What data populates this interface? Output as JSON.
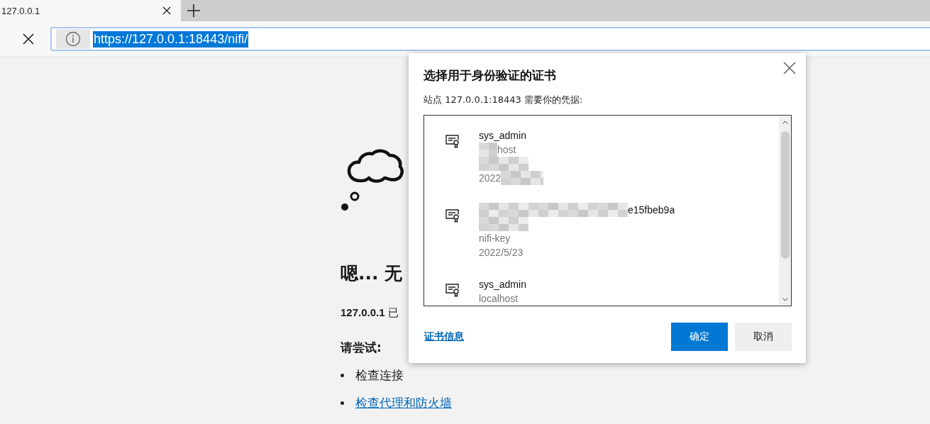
{
  "tab": {
    "title": "127.0.0.1"
  },
  "address_bar": {
    "url": "https://127.0.0.1:18443/nifi/",
    "url_selected": true
  },
  "error_page": {
    "heading": "嗯... 无",
    "message_host": "127.0.0.1",
    "message_rest": "已",
    "try_heading": "请尝试:",
    "suggestions": [
      {
        "text": "检查连接",
        "kind": "text"
      },
      {
        "text": "检查代理和防火墙",
        "kind": "link"
      }
    ]
  },
  "dialog": {
    "title": "选择用于身份验证的证书",
    "subtitle": "站点 127.0.0.1:18443 需要你的凭据:",
    "certificates": [
      {
        "selected": false,
        "lines": [
          {
            "kind": "name",
            "text": "sys_admin"
          },
          {
            "kind": "detail",
            "text": "host",
            "redacted_before": true
          },
          {
            "kind": "redacted"
          },
          {
            "kind": "detail",
            "text": "2022",
            "redacted_after": true
          }
        ]
      },
      {
        "selected": false,
        "lines": [
          {
            "kind": "name",
            "text": "e15fbeb9a",
            "redacted_before": true
          },
          {
            "kind": "redacted"
          },
          {
            "kind": "detail",
            "text": "nifi-key"
          },
          {
            "kind": "detail",
            "text": "2022/5/23"
          }
        ]
      },
      {
        "selected": false,
        "lines": [
          {
            "kind": "name",
            "text": "sys_admin"
          },
          {
            "kind": "detail",
            "text": "localhost"
          }
        ]
      }
    ],
    "info_link": "证书信息",
    "ok_button": "确定",
    "cancel_button": "取消"
  }
}
